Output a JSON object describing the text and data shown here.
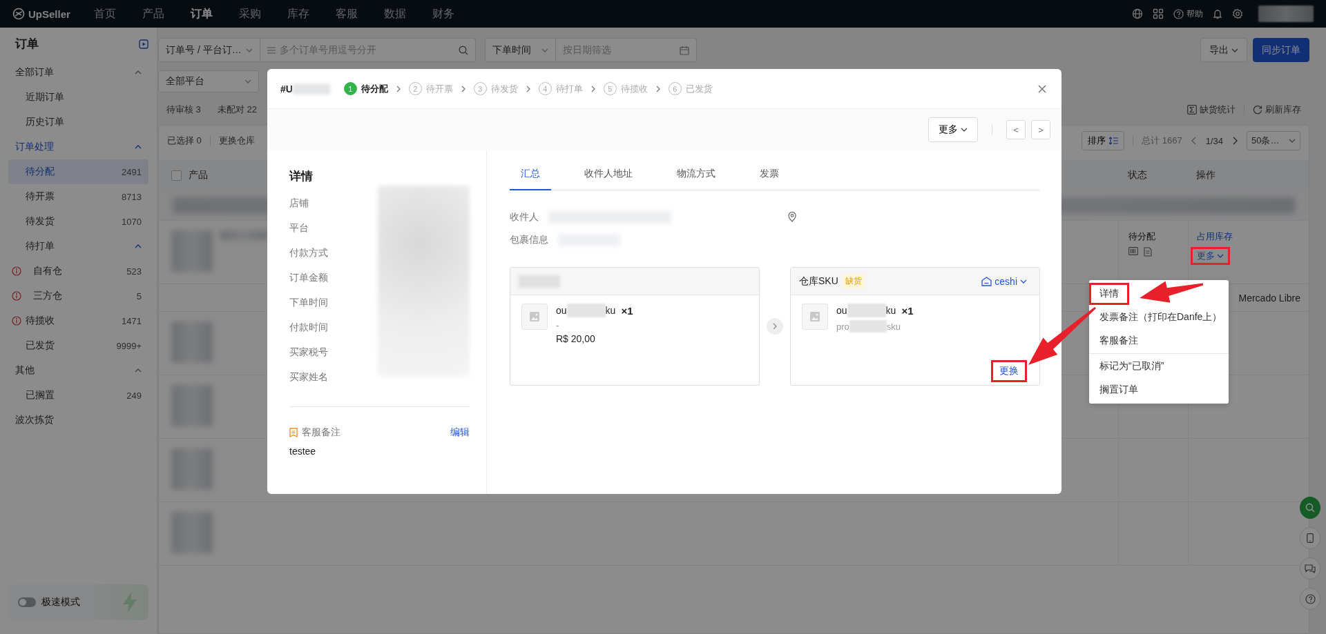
{
  "top_nav": {
    "logo": "UpSeller",
    "items": [
      {
        "label": "首页",
        "selected": false
      },
      {
        "label": "产品",
        "selected": false
      },
      {
        "label": "订单",
        "selected": true
      },
      {
        "label": "采购",
        "selected": false
      },
      {
        "label": "库存",
        "selected": false
      },
      {
        "label": "客服",
        "selected": false
      },
      {
        "label": "数据",
        "selected": false
      },
      {
        "label": "财务",
        "selected": false
      }
    ],
    "help": "帮助"
  },
  "sidebar": {
    "title": "订单",
    "groups": [
      {
        "label": "全部订单",
        "selected": false,
        "expanded": true,
        "children": [
          {
            "label": "近期订单",
            "selected": false,
            "alert": false
          },
          {
            "label": "历史订单",
            "selected": false,
            "alert": false
          }
        ]
      },
      {
        "label": "订单处理",
        "selected": true,
        "expanded": true,
        "children": [
          {
            "label": "待分配",
            "count": "2491",
            "selected": true,
            "alert": false
          },
          {
            "label": "待开票",
            "count": "8713",
            "selected": false,
            "alert": false
          },
          {
            "label": "待发货",
            "count": "1070",
            "selected": false,
            "alert": false
          },
          {
            "label": "待打单",
            "selected": false,
            "alert": false,
            "expanded": true,
            "children": [
              {
                "label": "自有仓",
                "count": "523",
                "selected": false,
                "alert": true
              },
              {
                "label": "三方仓",
                "count": "5",
                "selected": false,
                "alert": true
              }
            ]
          },
          {
            "label": "待揽收",
            "count": "1471",
            "selected": false,
            "alert": true
          },
          {
            "label": "已发货",
            "count": "9999+",
            "selected": false,
            "alert": false
          }
        ]
      },
      {
        "label": "其他",
        "selected": false,
        "expanded": true,
        "children": [
          {
            "label": "已搁置",
            "count": "249",
            "selected": false,
            "alert": false
          }
        ]
      },
      {
        "label": "波次拣货",
        "selected": false
      }
    ],
    "fast_mode": {
      "label": "极速模式",
      "on": false
    }
  },
  "filters": {
    "order_field": "订单号 / 平台订…",
    "search_placeholder": "多个订单号用逗号分开",
    "time_field": "下单时间",
    "date_placeholder": "按日期筛选",
    "platform": "全部平台"
  },
  "header_buttons": [
    {
      "label": "导出",
      "kind": "dropdown"
    },
    {
      "label": "同步订单",
      "kind": "primary"
    }
  ],
  "status_counts": [
    {
      "label": "待审核",
      "count": "3"
    },
    {
      "label": "未配对",
      "count": "22"
    }
  ],
  "stock_actions": [
    {
      "label": "缺货统计",
      "kind": "sigma"
    },
    {
      "label": "刷新库存",
      "kind": "refresh"
    }
  ],
  "table": {
    "select_all_checked": false,
    "selected_label": "已选择",
    "selected_count": "0",
    "toolbar": [
      "更换仓库"
    ],
    "sort": "排序",
    "total": "总计 1667",
    "page": "1/34",
    "page_size": "50条…",
    "columns": [
      {
        "label": "产品"
      },
      {
        "label": "状态"
      },
      {
        "label": "操作"
      }
    ],
    "order_row": {
      "status": "待分配",
      "actions": [
        {
          "label": "占用库存",
          "kind": "link",
          "highlighted": false
        },
        {
          "label": "更多",
          "kind": "dropdown",
          "highlighted": true
        }
      ]
    },
    "platform_row": {
      "platform": "Mercado Libre"
    }
  },
  "order_dialog": {
    "order_no": "#U",
    "steps": [
      {
        "number": "1",
        "label": "待分配",
        "selected": true
      },
      {
        "number": "2",
        "label": "待开票",
        "selected": false
      },
      {
        "number": "3",
        "label": "待发货",
        "selected": false
      },
      {
        "number": "4",
        "label": "待打单",
        "selected": false
      },
      {
        "number": "5",
        "label": "待揽收",
        "selected": false
      },
      {
        "number": "6",
        "label": "已发货",
        "selected": false
      }
    ],
    "more_button": "更多",
    "prev": "<",
    "next": ">",
    "details": {
      "title": "详情",
      "fields": [
        "店铺",
        "平台",
        "付款方式",
        "订单金额",
        "下单时间",
        "付款时间",
        "买家税号",
        "买家姓名"
      ],
      "note_label": "客服备注",
      "note_edit": "编辑",
      "note_text": "testee"
    },
    "tabs": [
      {
        "label": "汇总",
        "selected": true
      },
      {
        "label": "收件人地址",
        "selected": false
      },
      {
        "label": "物流方式",
        "selected": false
      },
      {
        "label": "发票",
        "selected": false
      }
    ],
    "recipient_label": "收件人",
    "package_label": "包裹信息",
    "platform_item": {
      "name_start": "ou",
      "name_end": "ku",
      "quantity": "×1",
      "variant": "-",
      "price": "R$ 20,00"
    },
    "warehouse_card": {
      "title": "仓库SKU",
      "tag": "缺货",
      "warehouse": "ceshi",
      "name_start": "ou",
      "name_end": "ku",
      "quantity": "×1",
      "sku_start": "pro",
      "sku_end": "sku",
      "replace": "更换",
      "replace_highlighted": true
    }
  },
  "context_menu": {
    "items": [
      {
        "label": "详情",
        "highlighted": true,
        "divider_before": false
      },
      {
        "label": "发票备注（打印在Danfe上）",
        "highlighted": false,
        "divider_before": false
      },
      {
        "label": "客服备注",
        "highlighted": false,
        "divider_before": false
      },
      {
        "label": "标记为“已取消”",
        "highlighted": false,
        "divider_before": true
      },
      {
        "label": "搁置订单",
        "highlighted": false,
        "divider_before": false
      }
    ]
  }
}
